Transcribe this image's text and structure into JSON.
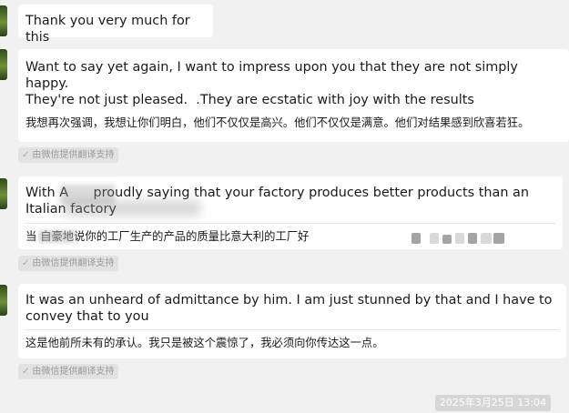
{
  "messages": [
    {
      "text": "Thank you very much for this"
    },
    {
      "text": "Want to say yet again, I want to impress upon you that they are not simply happy.\nThey're not just pleased.  .They are ecstatic with joy with the results",
      "translation": "我想再次强调，我想让你们明白，他们不仅仅是高兴。他们不仅仅是满意。他们对结果感到欣喜若狂。",
      "translation_badge": "由微信提供翻译支持"
    },
    {
      "text": "With A      proudly saying that your factory produces better products than an Italian factory",
      "translation": "当       自豪地说你的工厂生产的产品的质量比意大利的工厂好",
      "translation_badge": "由微信提供翻译支持"
    },
    {
      "text": "It was an unheard of admittance by him. I am just stunned by that and I have to convey that to you",
      "translation": "这是他前所未有的承认。我只是被这个震惊了，我必须向你传达这一点。",
      "translation_badge": "由微信提供翻译支持"
    }
  ],
  "timestamp": "2025年3月25日 13:04",
  "icons": {
    "translate_check": "check-circle-icon"
  },
  "colors": {
    "background": "#f1f1f1",
    "bubble": "#ffffff",
    "badge_bg": "#e2e2e2",
    "time_bg": "#d6d6d6"
  }
}
